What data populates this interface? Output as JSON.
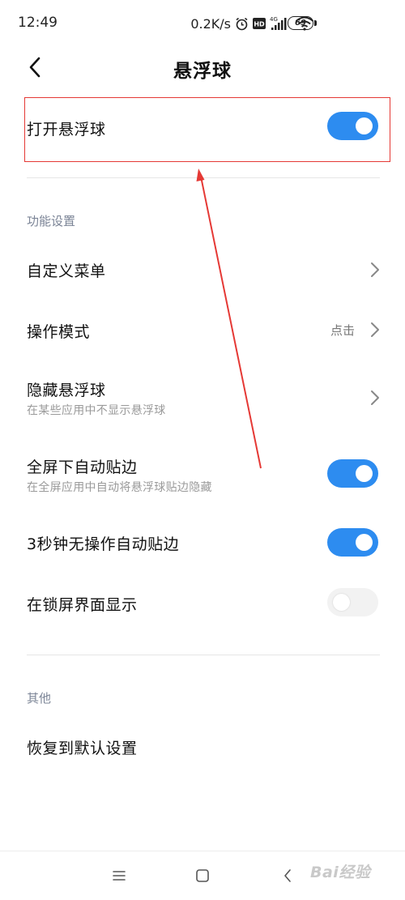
{
  "status_bar": {
    "time": "12:49",
    "speed": "0.2K/s",
    "network": "4G",
    "battery": "69"
  },
  "header": {
    "title": "悬浮球"
  },
  "main_toggle": {
    "label": "打开悬浮球",
    "on": true
  },
  "sections": {
    "function_settings": "功能设置",
    "other": "其他"
  },
  "items": {
    "custom_menu": {
      "label": "自定义菜单"
    },
    "operation_mode": {
      "label": "操作模式",
      "value": "点击"
    },
    "hide_ball": {
      "label": "隐藏悬浮球",
      "subtitle": "在某些应用中不显示悬浮球"
    },
    "fullscreen_edge": {
      "label": "全屏下自动贴边",
      "subtitle": "在全屏应用中自动将悬浮球贴边隐藏",
      "on": true
    },
    "idle_edge": {
      "label": "3秒钟无操作自动贴边",
      "on": true
    },
    "lockscreen": {
      "label": "在锁屏界面显示",
      "on": false
    },
    "restore": {
      "label": "恢复到默认设置"
    }
  },
  "watermark": "Bai经验",
  "colors": {
    "accent": "#2d8cf0",
    "annotation": "#e53935"
  }
}
